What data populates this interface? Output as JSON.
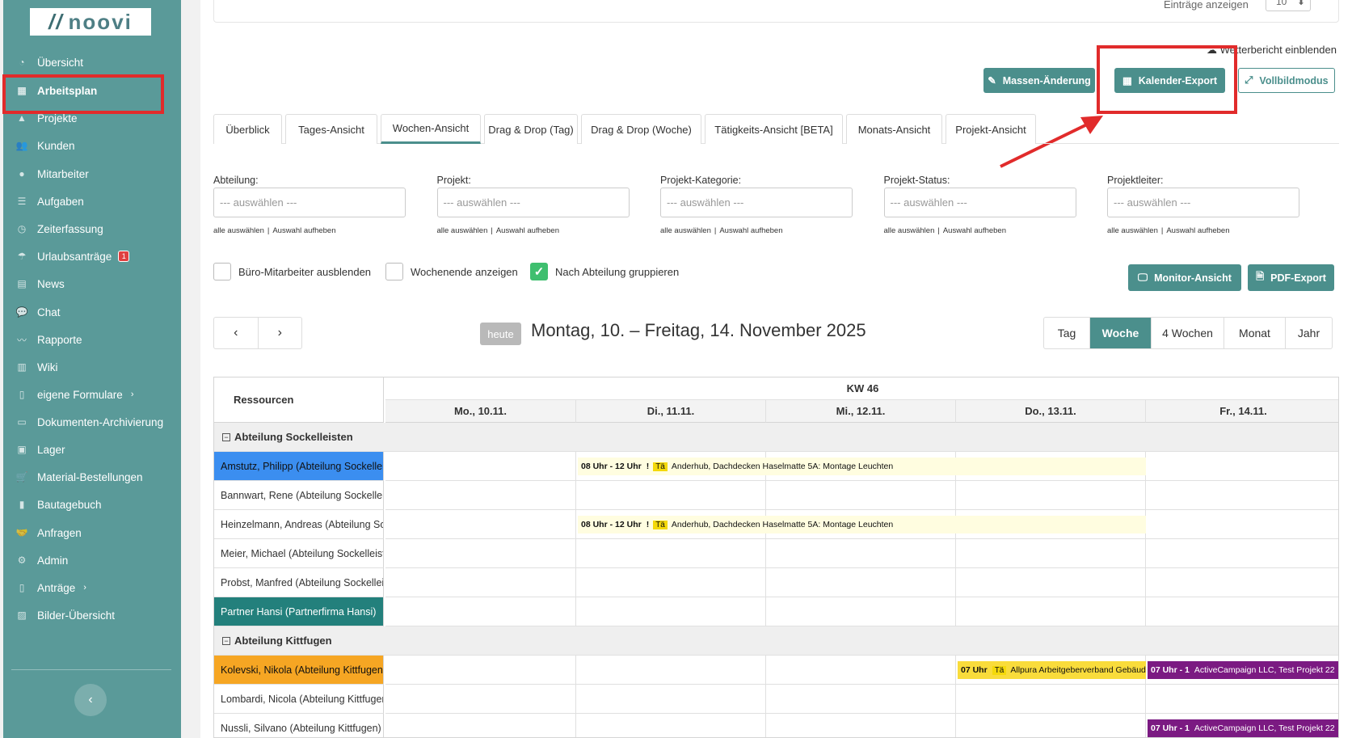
{
  "sidebar": {
    "logo_text": "noovi",
    "items": [
      {
        "label": "Übersicht",
        "icon": "dashboard-icon"
      },
      {
        "label": "Arbeitsplan",
        "icon": "calendar-icon"
      },
      {
        "label": "Projekte",
        "icon": "warning-icon"
      },
      {
        "label": "Kunden",
        "icon": "users-icon"
      },
      {
        "label": "Mitarbeiter",
        "icon": "user-icon"
      },
      {
        "label": "Aufgaben",
        "icon": "list-icon"
      },
      {
        "label": "Zeiterfassung",
        "icon": "user-clock-icon"
      },
      {
        "label": "Urlaubsanträge",
        "icon": "umbrella-icon",
        "badge": "1"
      },
      {
        "label": "News",
        "icon": "newspaper-icon"
      },
      {
        "label": "Chat",
        "icon": "comments-icon"
      },
      {
        "label": "Rapporte",
        "icon": "chart-line-icon"
      },
      {
        "label": "Wiki",
        "icon": "book-icon"
      },
      {
        "label": "eigene Formulare",
        "icon": "file-icon"
      },
      {
        "label": "Dokumenten-Archivierung",
        "icon": "archive-icon"
      },
      {
        "label": "Lager",
        "icon": "box-icon"
      },
      {
        "label": "Material-Bestellungen",
        "icon": "cart-icon"
      },
      {
        "label": "Bautagebuch",
        "icon": "notebook-icon"
      },
      {
        "label": "Anfragen",
        "icon": "handshake-icon"
      },
      {
        "label": "Admin",
        "icon": "gear-icon"
      },
      {
        "label": "Anträge",
        "icon": "document-icon"
      },
      {
        "label": "Bilder-Übersicht",
        "icon": "images-icon"
      }
    ],
    "collapse": "‹"
  },
  "header": {
    "entries_label": "Einträge anzeigen",
    "entries_value": "10",
    "weather_link": "Wetterbericht einblenden",
    "mass_edit": "Massen-Änderung",
    "calendar_export": "Kalender-Export",
    "fullscreen": "Vollbildmodus"
  },
  "tabs": [
    "Überblick",
    "Tages-Ansicht",
    "Wochen-Ansicht",
    "Drag & Drop (Tag)",
    "Drag & Drop (Woche)",
    "Tätigkeits-Ansicht [BETA]",
    "Monats-Ansicht",
    "Projekt-Ansicht"
  ],
  "active_tab": "Wochen-Ansicht",
  "filters": [
    {
      "label": "Abteilung:",
      "placeholder": "--- auswählen ---"
    },
    {
      "label": "Projekt:",
      "placeholder": "--- auswählen ---"
    },
    {
      "label": "Projekt-Kategorie:",
      "placeholder": "--- auswählen ---"
    },
    {
      "label": "Projekt-Status:",
      "placeholder": "--- auswählen ---"
    },
    {
      "label": "Projektleiter:",
      "placeholder": "--- auswählen ---"
    }
  ],
  "filter_links": {
    "select_all": "alle auswählen",
    "sep": "|",
    "clear": "Auswahl aufheben"
  },
  "checkboxes": [
    {
      "label": "Büro-Mitarbeiter ausblenden",
      "checked": false
    },
    {
      "label": "Wochenende anzeigen",
      "checked": false
    },
    {
      "label": "Nach Abteilung gruppieren",
      "checked": true
    }
  ],
  "monitor_view": "Monitor-Ansicht",
  "pdf_export": "PDF-Export",
  "calendar": {
    "prev": "‹",
    "next": "›",
    "today": "heute",
    "range": "Montag, 10. – Freitag, 14. November 2025",
    "views": [
      "Tag",
      "Woche",
      "4 Wochen",
      "Monat",
      "Jahr"
    ],
    "active_view": "Woche",
    "resources_header": "Ressourcen",
    "week": "KW 46",
    "days": [
      "Mo., 10.11.",
      "Di., 11.11.",
      "Mi., 12.11.",
      "Do., 13.11.",
      "Fr., 14.11."
    ]
  },
  "groups": [
    {
      "name": "Abteilung Sockelleisten",
      "rows": [
        {
          "name": "Amstutz, Philipp (Abteilung Sockelleisten)",
          "color": "#3b8ef0"
        },
        {
          "name": "Bannwart, Rene (Abteilung Sockelleisten)",
          "color": ""
        },
        {
          "name": "Heinzelmann, Andreas (Abteilung Sockelleisten)",
          "color": ""
        },
        {
          "name": "Meier, Michael (Abteilung Sockelleisten)",
          "color": ""
        },
        {
          "name": "Probst, Manfred (Abteilung Sockelleisten)",
          "color": ""
        },
        {
          "name": "Partner Hansi (Partnerfirma Hansi)",
          "color": "#23807c"
        }
      ]
    },
    {
      "name": "Abteilung Kittfugen",
      "rows": [
        {
          "name": "Kolevski, Nikola (Abteilung Kittfugen)",
          "color": "#f6a623"
        },
        {
          "name": "Lombardi, Nicola (Abteilung Kittfugen)",
          "color": ""
        },
        {
          "name": "Nussli, Silvano (Abteilung Kittfugen)",
          "color": ""
        }
      ]
    }
  ],
  "events": [
    {
      "row": 0,
      "time": "08 Uhr - 12 Uhr",
      "flag": "!",
      "tag": "Tä",
      "text": "Anderhub, Dachdecken Haselmatte 5A: Montage Leuchten",
      "color": "#fffde0"
    },
    {
      "row": 2,
      "time": "08 Uhr - 12 Uhr",
      "flag": "!",
      "tag": "Tä",
      "text": "Anderhub, Dachdecken Haselmatte 5A: Montage Leuchten",
      "color": "#fffde0"
    },
    {
      "row": 6,
      "time": "07 Uhr",
      "flag": "",
      "tag": "Tä",
      "text": "Allpura Arbeitgeberverband Gebäudetechnik",
      "color": "#f9dc3b"
    },
    {
      "row": 6,
      "time": "07 Uhr - 1",
      "flag": "",
      "tag": "",
      "text": "ActiveCampaign LLC, Test Projekt 22",
      "color": "#7b1a82"
    },
    {
      "row": 8,
      "time": "07 Uhr - 1",
      "flag": "",
      "tag": "",
      "text": "ActiveCampaign LLC, Test Projekt 22",
      "color": "#7b1a82"
    }
  ]
}
